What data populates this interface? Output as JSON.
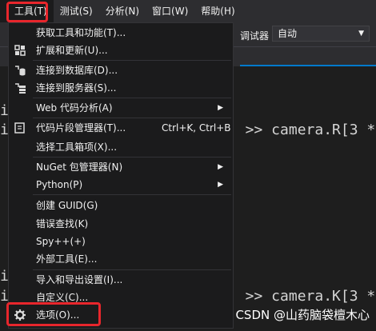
{
  "menubar": {
    "items": [
      {
        "label": "工具(T)"
      },
      {
        "label": "测试(S)"
      },
      {
        "label": "分析(N)"
      },
      {
        "label": "窗口(W)"
      },
      {
        "label": "帮助(H)"
      }
    ]
  },
  "toolbar": {
    "debugger_label": "调试器",
    "config_value": "自动"
  },
  "code": {
    "line1": "] >> camera.R[3 *",
    "line2": "] >> camera.K[3 *",
    "gutter": [
      "i",
      "i",
      "i",
      "i"
    ]
  },
  "dropdown": {
    "items": [
      {
        "label": "获取工具和功能(T)...",
        "icon": "none"
      },
      {
        "label": "扩展和更新(U)...",
        "icon": "extensions-icon"
      },
      {
        "label": "连接到数据库(D)...",
        "icon": "database-connect-icon"
      },
      {
        "label": "连接到服务器(S)...",
        "icon": "server-connect-icon"
      },
      {
        "label": "Web 代码分析(A)",
        "icon": "none",
        "submenu": true
      },
      {
        "label": "代码片段管理器(T)...",
        "shortcut": "Ctrl+K, Ctrl+B",
        "icon": "snippet-icon"
      },
      {
        "label": "选择工具箱项(X)...",
        "icon": "none"
      },
      {
        "label": "NuGet 包管理器(N)",
        "icon": "none",
        "submenu": true
      },
      {
        "label": "Python(P)",
        "icon": "none",
        "submenu": true
      },
      {
        "label": "创建 GUID(G)",
        "icon": "none"
      },
      {
        "label": "错误查找(K)",
        "icon": "none"
      },
      {
        "label": "Spy++(+)",
        "icon": "none"
      },
      {
        "label": "外部工具(E)...",
        "icon": "none"
      },
      {
        "label": "导入和导出设置(I)...",
        "icon": "none"
      },
      {
        "label": "自定义(C)...",
        "icon": "none"
      },
      {
        "label": "选项(O)...",
        "icon": "gear-icon"
      }
    ]
  },
  "watermark": "CSDN @山药脑袋檀木心",
  "colors": {
    "highlight": "#e8262c",
    "menu_bg": "#1b1b1c",
    "bar_bg": "#2d2d30",
    "accent": "#007acc"
  }
}
